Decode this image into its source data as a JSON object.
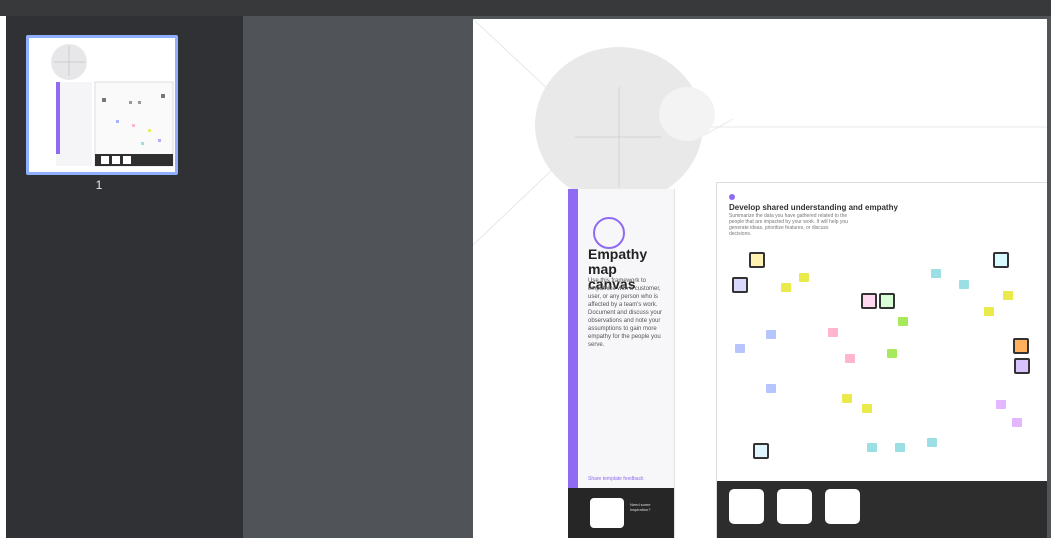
{
  "sidebar": {
    "page_number": "1"
  },
  "canvas": {
    "title": "Empathy map canvas",
    "description": "Use this framework to empathize with a customer, user, or any person who is affected by a team's work. Document and discuss your observations and note your assumptions to gain more empathy for the people you serve.",
    "section_title": "Develop shared understanding and empathy",
    "section_description": "Summarize the data you have gathered related to the people that are impacted by your work. It will help you generate ideas, prioritize features, or discuss decisions.",
    "footer_label": "Need some inspiration?",
    "cta_label": "Share template feedback"
  },
  "colors": {
    "accent": "#8f6af2",
    "thumbnail_border": "#8eb0ff"
  }
}
